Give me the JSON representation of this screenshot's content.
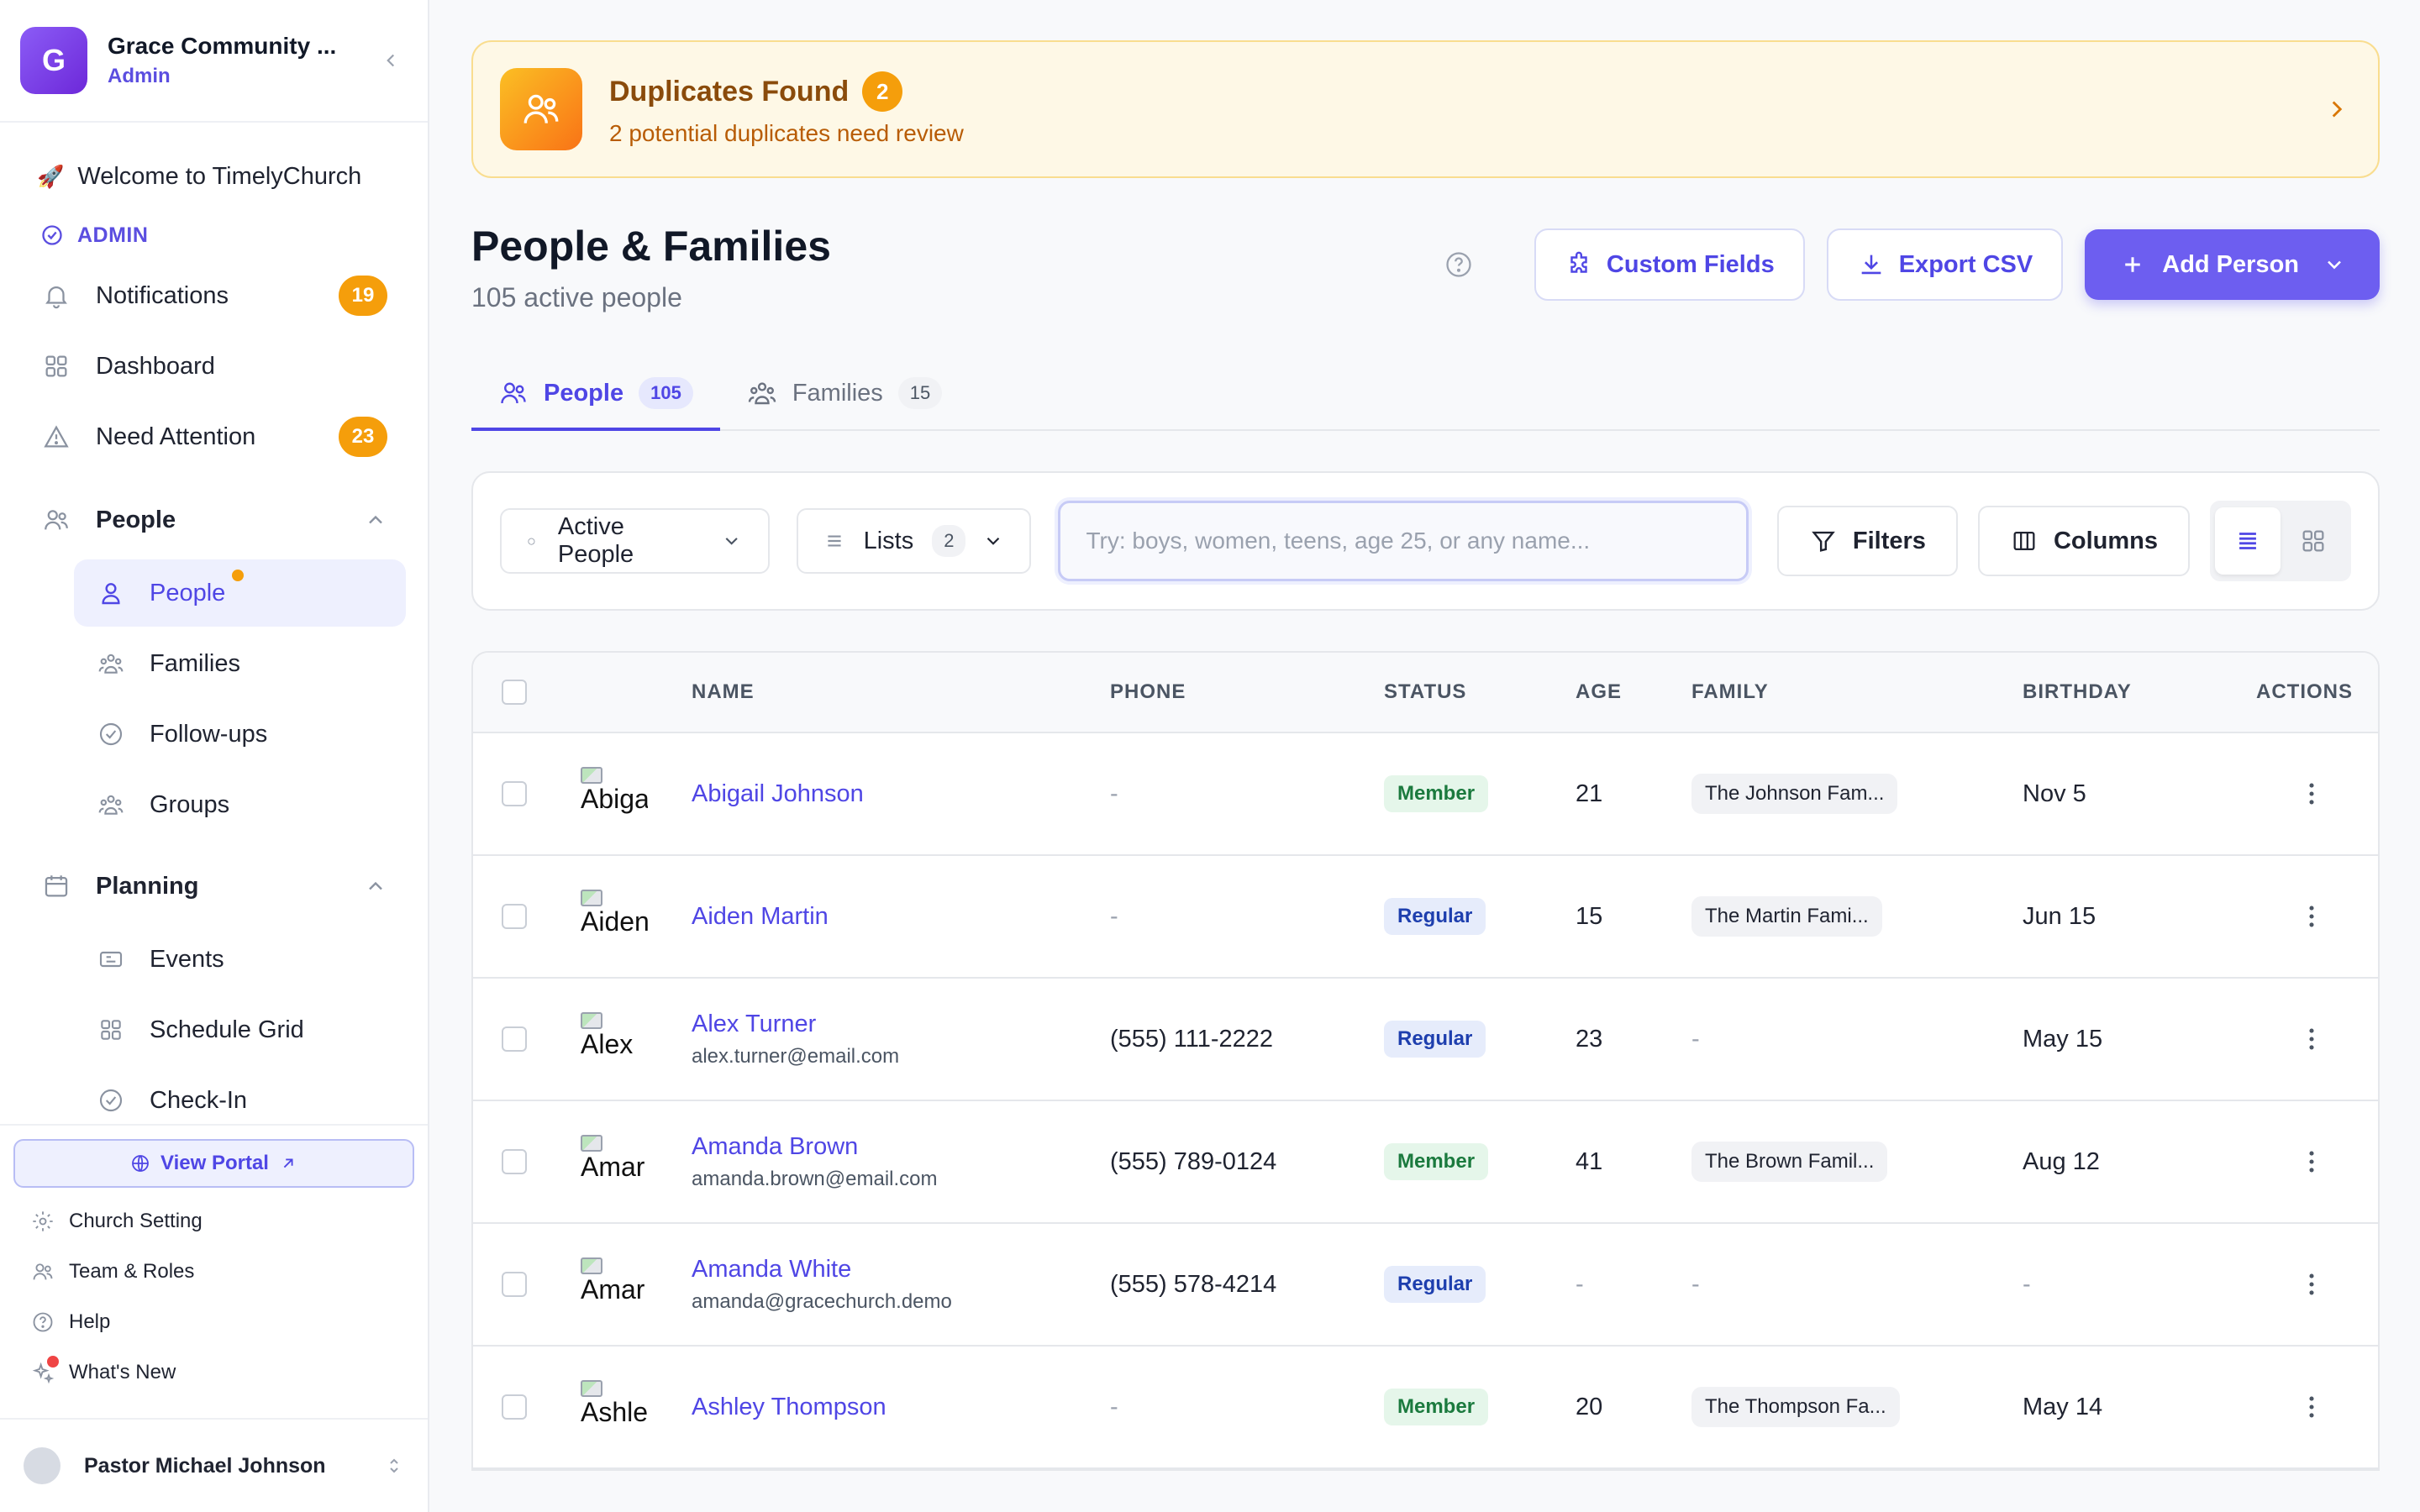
{
  "org": {
    "initial": "G",
    "name": "Grace Community ...",
    "role": "Admin"
  },
  "sidebar": {
    "welcome": "Welcome to TimelyChurch",
    "section_label": "ADMIN",
    "top_items": [
      {
        "label": "Notifications",
        "badge": "19"
      },
      {
        "label": "Dashboard"
      },
      {
        "label": "Need Attention",
        "badge": "23"
      }
    ],
    "people_group": {
      "label": "People",
      "items": [
        "People",
        "Families",
        "Follow-ups",
        "Groups"
      ]
    },
    "planning_group": {
      "label": "Planning",
      "items": [
        "Events",
        "Schedule Grid",
        "Check-In"
      ]
    },
    "view_portal": "View Portal",
    "footer_links": [
      "Church Setting",
      "Team & Roles",
      "Help",
      "What's New"
    ],
    "user": {
      "name": "Pastor Michael Johnson"
    }
  },
  "banner": {
    "title": "Duplicates Found",
    "count": "2",
    "subtitle": "2 potential duplicates need review"
  },
  "page": {
    "title": "People & Families",
    "subtitle": "105 active people",
    "custom_fields": "Custom Fields",
    "export_csv": "Export CSV",
    "add_person": "Add Person"
  },
  "tabs": [
    {
      "label": "People",
      "count": "105"
    },
    {
      "label": "Families",
      "count": "15"
    }
  ],
  "toolbar": {
    "view_select": "Active People",
    "lists": "Lists",
    "lists_count": "2",
    "search_placeholder": "Try: boys, women, teens, age 25, or any name...",
    "filters": "Filters",
    "columns": "Columns"
  },
  "table": {
    "headers": {
      "name": "NAME",
      "phone": "PHONE",
      "status": "STATUS",
      "age": "AGE",
      "family": "FAMILY",
      "birthday": "BIRTHDAY",
      "actions": "ACTIONS"
    },
    "rows": [
      {
        "avatar_alt": "Abiga",
        "name": "Abigail Johnson",
        "email": "",
        "phone": "-",
        "status": "Member",
        "age": "21",
        "family": "The Johnson Fam...",
        "birthday": "Nov 5"
      },
      {
        "avatar_alt": "Aiden",
        "name": "Aiden Martin",
        "email": "",
        "phone": "-",
        "status": "Regular",
        "age": "15",
        "family": "The Martin Fami...",
        "birthday": "Jun 15"
      },
      {
        "avatar_alt": "Alex",
        "name": "Alex Turner",
        "email": "alex.turner@email.com",
        "phone": "(555) 111-2222",
        "status": "Regular",
        "age": "23",
        "family": "-",
        "birthday": "May 15"
      },
      {
        "avatar_alt": "Amar",
        "name": "Amanda Brown",
        "email": "amanda.brown@email.com",
        "phone": "(555) 789-0124",
        "status": "Member",
        "age": "41",
        "family": "The Brown Famil...",
        "birthday": "Aug 12"
      },
      {
        "avatar_alt": "Amar",
        "name": "Amanda White",
        "email": "amanda@gracechurch.demo",
        "phone": "(555) 578-4214",
        "status": "Regular",
        "age": "-",
        "family": "-",
        "birthday": "-"
      },
      {
        "avatar_alt": "Ashle",
        "name": "Ashley Thompson",
        "email": "",
        "phone": "-",
        "status": "Member",
        "age": "20",
        "family": "The Thompson Fa...",
        "birthday": "May 14"
      }
    ]
  },
  "colors": {
    "accent": "#4f46e5",
    "primary_button": "#6d5ef0",
    "badge": "#f59e0b",
    "banner_bg": "#fef8e6"
  }
}
